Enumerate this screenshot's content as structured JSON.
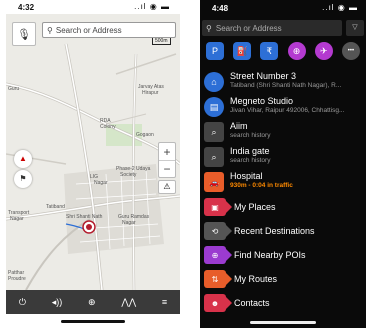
{
  "left_phone": {
    "status_time": "4:32",
    "status_indicators": "..ıl ◉ ▬",
    "search_placeholder": "Search or Address",
    "scale_label": "500m",
    "map_labels": [
      "Jarvay Atas",
      "Hirapur",
      "Guru",
      "RDA",
      "Colony",
      "Gogaon",
      "LIG",
      "Phase-2 Udaya",
      "Society",
      "Nagar",
      "Tatiband",
      "Transport",
      "Nagar",
      "Shri Shanti Nath",
      "Guru Ramdas",
      "Nagar",
      "Patthar",
      "Proudre"
    ],
    "toolbar": [
      "⏻",
      "◂))",
      "⊕",
      "⋀⋀",
      "≡"
    ],
    "icons": {
      "mic": "mic-icon",
      "search": "search-icon",
      "compass": "compass-icon",
      "flag": "flag-icon",
      "warning": "warning-icon",
      "location_pin": "location-pin-icon"
    }
  },
  "right_phone": {
    "status_time": "4:48",
    "status_indicators": "..ıl ◉ ▬",
    "search_placeholder": "Search or Address",
    "quick_actions": [
      {
        "icon": "parking-icon",
        "color": "#2d6fd6",
        "glyph": "P"
      },
      {
        "icon": "fuel-icon",
        "color": "#2d6fd6",
        "glyph": "⛽"
      },
      {
        "icon": "rupee-icon",
        "color": "#2d6fd6",
        "glyph": "₹"
      },
      {
        "icon": "hospital-icon",
        "color": "#b43ad0",
        "glyph": "⊕"
      },
      {
        "icon": "airplane-icon",
        "color": "#b43ad0",
        "glyph": "✈"
      },
      {
        "icon": "more-icon",
        "color": "#555555",
        "glyph": "•••"
      }
    ],
    "recent": [
      {
        "title": "Street Number 3",
        "subtitle": "Tatiband (Shri Shanti Nath Nagar), R...",
        "icon": "home-icon",
        "color": "#2d6fd6",
        "glyph": "⌂"
      },
      {
        "title": "Megneto Studio",
        "subtitle": "Jivan Vihar, Raipur 492006, Chhattisg...",
        "icon": "work-icon",
        "color": "#2d6fd6",
        "glyph": "▤"
      },
      {
        "title": "Aiim",
        "subtitle": "search history",
        "icon": "search-icon",
        "color": "#444444",
        "glyph": "⌕"
      },
      {
        "title": "India gate",
        "subtitle": "search history",
        "icon": "search-icon",
        "color": "#444444",
        "glyph": "⌕"
      },
      {
        "title": "Hospital",
        "subtitle": "930m - 0:04 in traffic",
        "icon": "car-icon",
        "color": "#e85d2a",
        "glyph": "🚗"
      }
    ],
    "menu": [
      {
        "label": "My Places",
        "icon": "my-places-icon",
        "color": "#d8324a",
        "glyph": "▣"
      },
      {
        "label": "Recent Destinations",
        "icon": "recent-destinations-icon",
        "color": "#555555",
        "glyph": "⟲"
      },
      {
        "label": "Find Nearby POIs",
        "icon": "nearby-poi-icon",
        "color": "#9b3bd0",
        "glyph": "⊕"
      },
      {
        "label": "My Routes",
        "icon": "my-routes-icon",
        "color": "#e85d2a",
        "glyph": "⇅"
      },
      {
        "label": "Contacts",
        "icon": "contacts-icon",
        "color": "#d8324a",
        "glyph": "☻"
      }
    ]
  }
}
